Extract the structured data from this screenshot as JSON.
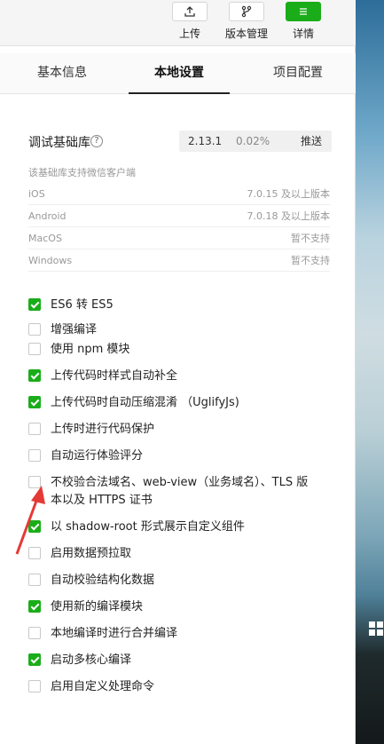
{
  "toolbar": {
    "upload_label": "上传",
    "version_label": "版本管理",
    "details_label": "详情"
  },
  "tabs": [
    "基本信息",
    "本地设置",
    "项目配置"
  ],
  "base_library": {
    "title": "调试基础库",
    "help": "?",
    "version": "2.13.1",
    "percent": "0.02%",
    "push_label": "推送"
  },
  "support": {
    "note": "该基础库支持微信客户端",
    "rows": [
      {
        "platform": "iOS",
        "value": "7.0.15 及以上版本"
      },
      {
        "platform": "Android",
        "value": "7.0.18 及以上版本"
      },
      {
        "platform": "MacOS",
        "value": "暂不支持"
      },
      {
        "platform": "Windows",
        "value": "暂不支持"
      }
    ]
  },
  "options": [
    {
      "label": "ES6 转 ES5",
      "checked": true
    },
    {
      "label": "增强编译",
      "checked": false
    },
    {
      "label": "使用 npm 模块",
      "checked": false
    },
    {
      "label": "上传代码时样式自动补全",
      "checked": true
    },
    {
      "label": "上传代码时自动压缩混淆 （UglifyJs)",
      "checked": true
    },
    {
      "label": "上传时进行代码保护",
      "checked": false
    },
    {
      "label": "自动运行体验评分",
      "checked": false
    },
    {
      "label": "不校验合法域名、web-view（业务域名）、TLS 版本以及 HTTPS 证书",
      "checked": false
    },
    {
      "label": "以 shadow-root 形式展示自定义组件",
      "checked": true
    },
    {
      "label": "启用数据预拉取",
      "checked": false
    },
    {
      "label": "自动校验结构化数据",
      "checked": false
    },
    {
      "label": "使用新的编译模块",
      "checked": true
    },
    {
      "label": "本地编译时进行合并编译",
      "checked": false
    },
    {
      "label": "启动多核心编译",
      "checked": true
    },
    {
      "label": "启用自定义处理命令",
      "checked": false
    }
  ],
  "colors": {
    "accent": "#1aad19",
    "arrow": "#e53935"
  }
}
